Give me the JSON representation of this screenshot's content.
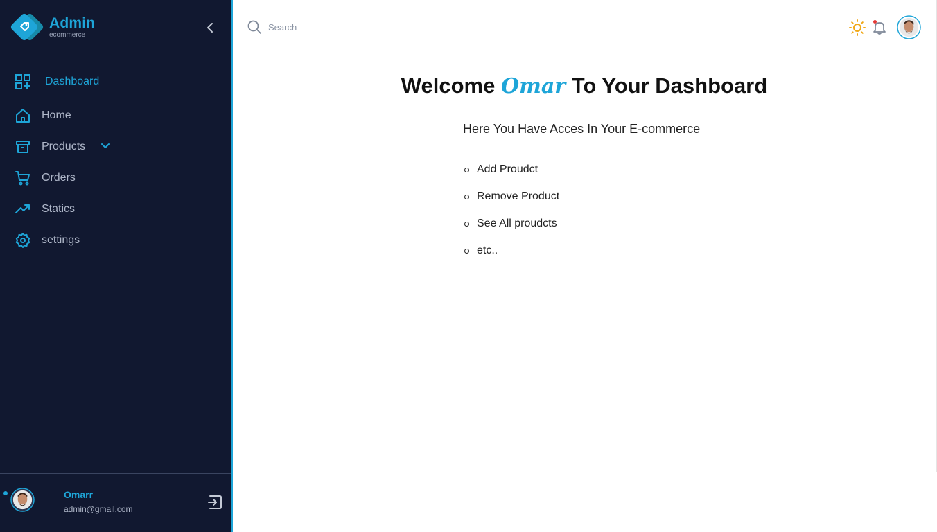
{
  "brand": {
    "title": "Admin",
    "subtitle": "ecommerce"
  },
  "sidebar": {
    "items": [
      {
        "label": "Dashboard",
        "icon": "dashboard-icon",
        "active": true
      },
      {
        "label": "Home",
        "icon": "home-icon"
      },
      {
        "label": "Products",
        "icon": "archive-box-icon",
        "has_submenu": true
      },
      {
        "label": "Orders",
        "icon": "cart-icon"
      },
      {
        "label": "Statics",
        "icon": "trending-up-icon"
      },
      {
        "label": "settings",
        "icon": "gear-icon"
      }
    ]
  },
  "user": {
    "name": "Omarr",
    "email": "admin@gmail,com"
  },
  "header": {
    "search_placeholder": "Search"
  },
  "main": {
    "welcome_prefix": "Welcome",
    "welcome_name": "Omar",
    "welcome_suffix": "To Your Dashboard",
    "subtitle": "Here You Have Acces In Your E-commerce",
    "features": [
      "Add Proudct",
      "Remove Product",
      "See All proudcts",
      "etc.."
    ]
  },
  "colors": {
    "accent": "#1ea5d8",
    "sidebar_bg": "#111830",
    "sun": "#f0a818",
    "notification": "#e53935"
  }
}
